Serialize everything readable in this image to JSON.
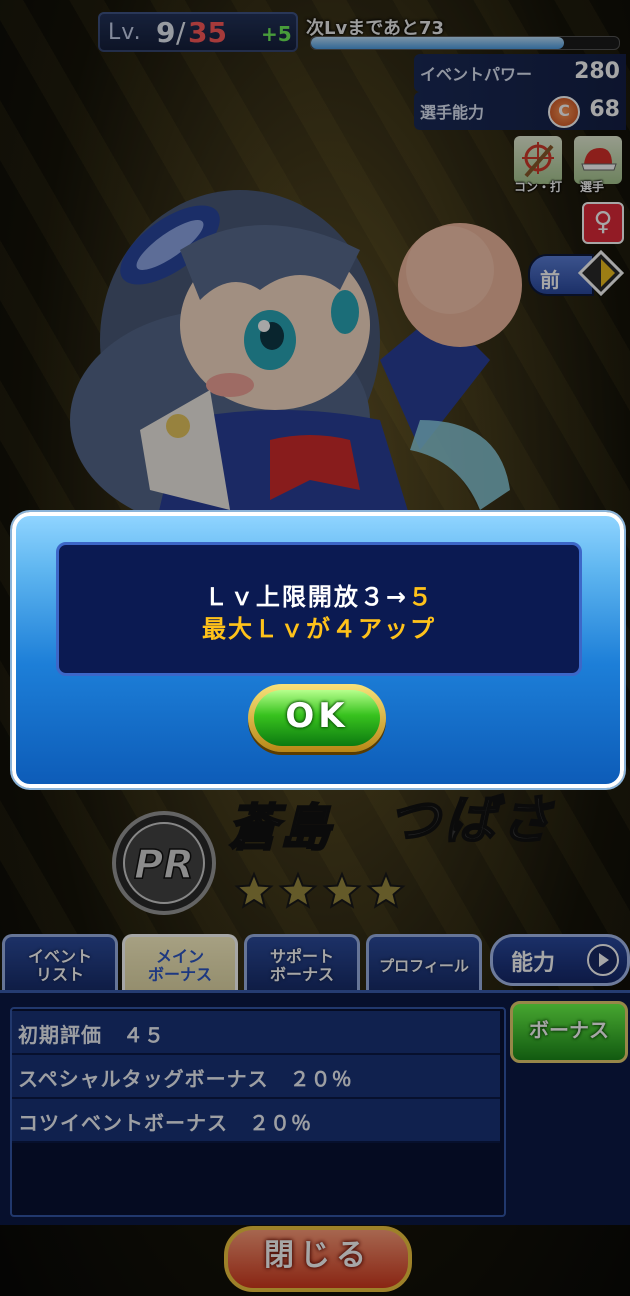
{
  "status": {
    "lv_prefix": "Lv.",
    "lv_current": "9",
    "lv_slash": "/",
    "lv_max": "35",
    "lv_plus": "+5",
    "next_lv_label": "次Lvまであと73",
    "exp_progress": 0.82,
    "event_power_label": "イベントパワー",
    "event_power_value": "280",
    "player_ability_label": "選手能力",
    "rank_letter": "C",
    "player_ability_value": "68"
  },
  "side_buttons": {
    "con_bat_caption": "コン・打",
    "player_caption": "選手",
    "gender_symbol": "♀",
    "prev_label": "前"
  },
  "character": {
    "rarity_badge": "PR",
    "name_family": "蒼島",
    "name_given": "つばさ",
    "star_count": 4
  },
  "tabs": {
    "event_list": "イベント\nリスト",
    "main_bonus": "メイン\nボーナス",
    "support_bonus": "サポート\nボーナス",
    "profile": "プロフィール",
    "ability": "能力"
  },
  "bonus": {
    "rows": [
      "初期評価　４５",
      "スペシャルタッグボーナス　２０％",
      "コツイベントボーナス　２０％"
    ],
    "button_label": "ボーナス"
  },
  "close_label": "閉じる",
  "dialog": {
    "line1_prefix": "Ｌｖ上限開放３→",
    "line1_highlight": "５",
    "line2": "最大Ｌｖが４アップ",
    "ok_label": "OK"
  },
  "colors": {
    "accent_gold": "#ffc21a",
    "lv_max_red": "#ff5a5a",
    "plus_green": "#6ff05a"
  }
}
